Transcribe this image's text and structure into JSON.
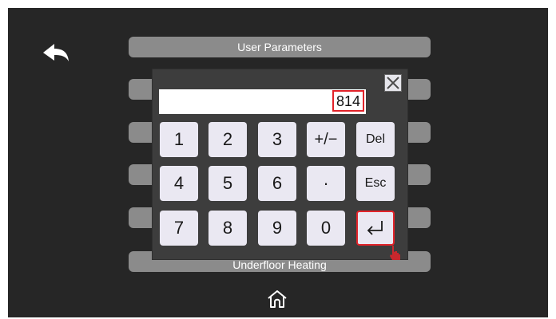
{
  "window": {
    "title": "User Parameters",
    "bottom_pill_label": "Underfloor Heating"
  },
  "navigation": {
    "back_icon": "back-arrow-icon",
    "home_icon": "home-icon"
  },
  "keypad": {
    "display_value": "814",
    "keys": {
      "k1": "1",
      "k2": "2",
      "k3": "3",
      "plus_minus": "+/−",
      "del": "Del",
      "k4": "4",
      "k5": "5",
      "k6": "6",
      "dot": "·",
      "esc": "Esc",
      "k7": "7",
      "k8": "8",
      "k9": "9",
      "k0": "0"
    },
    "enter_icon": "enter-return-icon",
    "close_icon": "close-icon"
  },
  "colors": {
    "screen_bg": "#262626",
    "pill_bg": "#8b8b8b",
    "keypad_bg": "#3d3d3d",
    "key_bg": "#eae8f2",
    "highlight": "#e2232a"
  }
}
